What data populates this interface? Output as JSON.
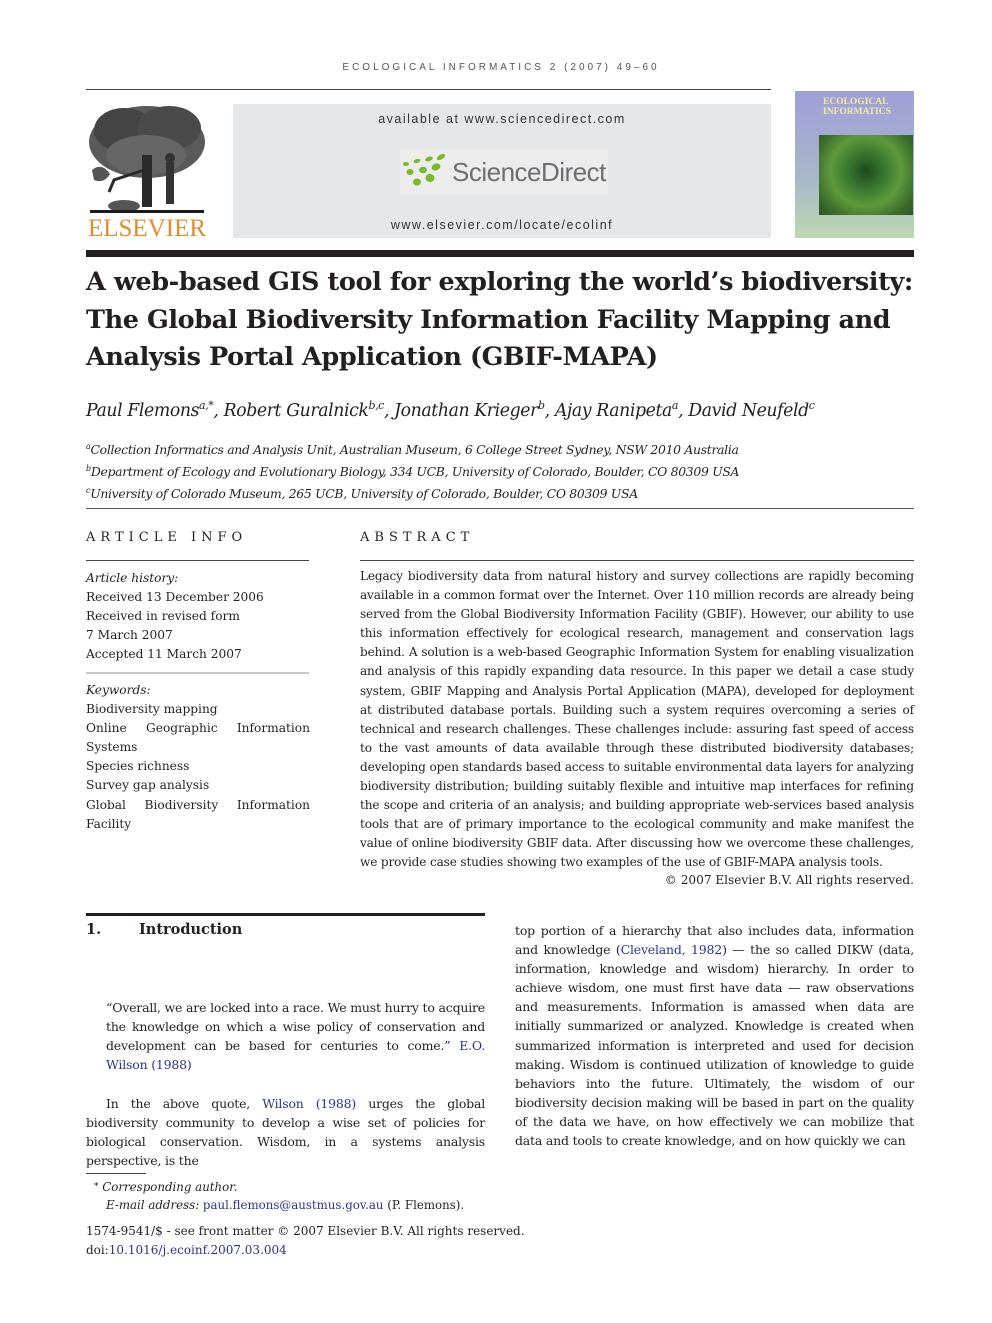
{
  "running_head": "ECOLOGICAL INFORMATICS 2 (2007) 49–60",
  "header": {
    "publisher_logo_text": "ELSEVIER",
    "banner_available": "available at www.sciencedirect.com",
    "banner_brand": "ScienceDirect",
    "banner_url": "www.elsevier.com/locate/ecolinf",
    "cover_title_line1": "ECOLOGICAL",
    "cover_title_line2": "INFORMATICS",
    "colors": {
      "elsevier_orange": "#e58a2e",
      "sciencedirect_green": "#7ab929",
      "banner_gray": "#e6e7e8",
      "link_blue": "#2e3192"
    }
  },
  "article": {
    "title_line1": "A web-based GIS tool for exploring the world’s biodiversity:",
    "title_line2": "The Global Biodiversity Information Facility Mapping and",
    "title_line3": "Analysis Portal Application (GBIF-MAPA)",
    "authors": [
      {
        "name": "Paul Flemons",
        "sup": "a,*",
        "sep": ", "
      },
      {
        "name": "Robert Guralnick",
        "sup": "b,c",
        "sep": ", "
      },
      {
        "name": "Jonathan Krieger",
        "sup": "b",
        "sep": ", "
      },
      {
        "name": "Ajay Ranipeta",
        "sup": "a",
        "sep": ", "
      },
      {
        "name": "David Neufeld",
        "sup": "c",
        "sep": ""
      }
    ],
    "affiliations": [
      {
        "sup": "a",
        "text": "Collection Informatics and Analysis Unit, Australian Museum, 6 College Street Sydney, NSW 2010 Australia"
      },
      {
        "sup": "b",
        "text": "Department of Ecology and Evolutionary Biology, 334 UCB, University of Colorado, Boulder, CO 80309 USA"
      },
      {
        "sup": "c",
        "text": "University of Colorado Museum, 265 UCB, University of Colorado, Boulder, CO 80309 USA"
      }
    ]
  },
  "article_info": {
    "heading": "ARTICLE INFO",
    "history_label": "Article history:",
    "history": [
      "Received 13 December 2006",
      "Received in revised form",
      "7 March 2007",
      "Accepted 11 March 2007"
    ],
    "keywords_label": "Keywords:",
    "keywords": [
      {
        "text": "Biodiversity mapping",
        "justify": false
      },
      {
        "text": "Online Geographic Information",
        "justify": true
      },
      {
        "text": "Systems",
        "justify": false
      },
      {
        "text": "Species richness",
        "justify": false
      },
      {
        "text": "Survey gap analysis",
        "justify": false
      },
      {
        "text": "Global Biodiversity Information",
        "justify": true
      },
      {
        "text": "Facility",
        "justify": false
      }
    ]
  },
  "abstract": {
    "heading": "ABSTRACT",
    "text": "Legacy biodiversity data from natural history and survey collections are rapidly becoming available in a common format over the Internet. Over 110 million records are already being served from the Global Biodiversity Information Facility (GBIF). However, our ability to use this information effectively for ecological research, management and conservation lags behind. A solution is a web-based Geographic Information System for enabling visualization and analysis of this rapidly expanding data resource. In this paper we detail a case study system, GBIF Mapping and Analysis Portal Application (MAPA), developed for deployment at distributed database portals. Building such a system requires overcoming a series of technical and research challenges. These challenges include: assuring fast speed of access to the vast amounts of data available through these distributed biodiversity databases; developing open standards based access to suitable environmental data layers for analyzing biodiversity distribution; building suitably flexible and intuitive map interfaces for refining the scope and criteria of an analysis; and building appropriate web-services based analysis tools that are of primary importance to the ecological community and make manifest the value of online biodiversity GBIF data. After discussing how we overcome these challenges, we provide case studies showing two examples of the use of GBIF-MAPA analysis tools.",
    "copyright": "© 2007 Elsevier B.V. All rights reserved."
  },
  "introduction": {
    "number": "1.",
    "heading": "Introduction",
    "quote_text": "“Overall, we are locked into a race. We must hurry to acquire the knowledge on which a wise policy of conservation and development can be based for centuries to come.” ",
    "quote_cite": "E.O. Wilson (1988)",
    "para1_pre": "In the above quote, ",
    "para1_link": "Wilson (1988)",
    "para1_post": " urges the global biodiversity community to develop a wise set of policies for biological conservation. Wisdom, in a systems analysis perspective, is the",
    "col2_pre": "top portion of a hierarchy that also includes data, information and knowledge (",
    "col2_link": "Cleveland, 1982",
    "col2_post": ") — the so called DIKW (data, information, knowledge and wisdom) hierarchy. In order to achieve wisdom, one must first have data — raw observations and measurements. Information is amassed when data are initially summarized or analyzed. Knowledge is created when summarized information is interpreted and used for decision making. Wisdom is continued utilization of knowledge to guide behaviors into the future. Ultimately, the wisdom of our biodiversity decision making will be based in part on the quality of the data we have, on how effectively we can mobilize that data and tools to create knowledge, and on how quickly we can"
  },
  "footnotes": {
    "marker": "*",
    "corresponding": "Corresponding author.",
    "email_label": "E-mail address:",
    "email": "paul.flemons@austmus.gov.au",
    "email_suffix": " (P. Flemons).",
    "front_matter": "1574-9541/$ - see front matter © 2007 Elsevier B.V. All rights reserved.",
    "doi_label": "doi:",
    "doi": "10.1016/j.ecoinf.2007.03.004"
  }
}
